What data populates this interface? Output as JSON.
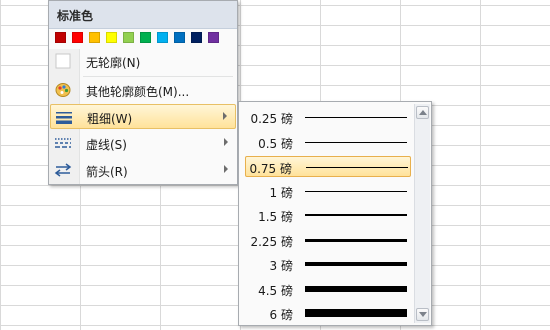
{
  "menu": {
    "section_title": "标准色",
    "standard_colors": [
      "#c00000",
      "#ff0000",
      "#ffc000",
      "#ffff00",
      "#92d050",
      "#00b050",
      "#00b0f0",
      "#0070c0",
      "#002060",
      "#7030a0"
    ],
    "items": [
      {
        "label": "无轮廓(N)",
        "icon": "no-outline-icon",
        "has_submenu": false
      },
      {
        "label": "其他轮廓颜色(M)...",
        "icon": "palette-icon",
        "has_submenu": false
      },
      {
        "label": "粗细(W)",
        "icon": "line-weight-icon",
        "has_submenu": true,
        "highlighted": true
      },
      {
        "label": "虚线(S)",
        "icon": "dash-icon",
        "has_submenu": true
      },
      {
        "label": "箭头(R)",
        "icon": "arrows-icon",
        "has_submenu": true
      }
    ]
  },
  "weight_submenu": {
    "options": [
      {
        "label": "0.25 磅",
        "weight": 0.25
      },
      {
        "label": "0.5 磅",
        "weight": 0.5
      },
      {
        "label": "0.75 磅",
        "weight": 0.75,
        "selected": true
      },
      {
        "label": "1 磅",
        "weight": 1
      },
      {
        "label": "1.5 磅",
        "weight": 1.5
      },
      {
        "label": "2.25 磅",
        "weight": 2.25
      },
      {
        "label": "3 磅",
        "weight": 3
      },
      {
        "label": "4.5 磅",
        "weight": 4.5
      },
      {
        "label": "6 磅",
        "weight": 6
      }
    ]
  }
}
